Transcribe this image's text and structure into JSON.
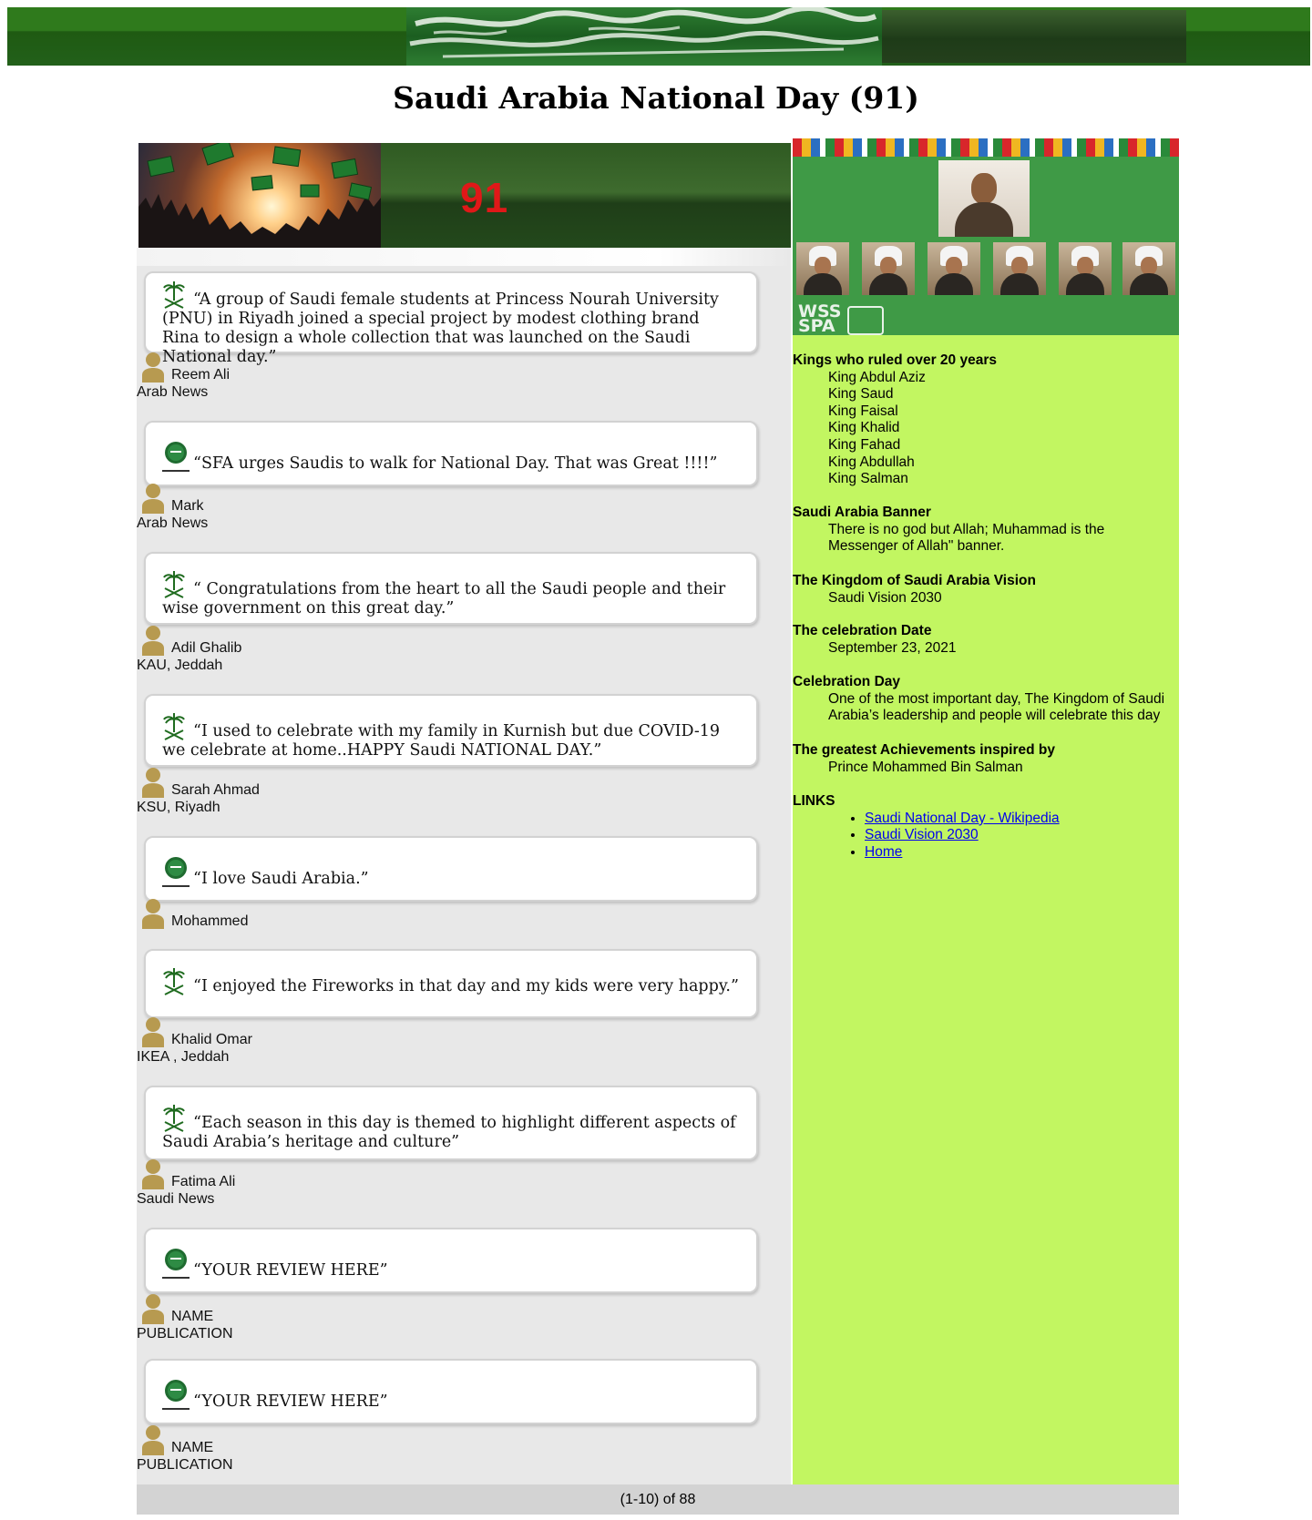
{
  "page_title": "Saudi Arabia National Day (91)",
  "header": {
    "badge_number": "91"
  },
  "reviews": [
    {
      "quote": "“A group of Saudi female students at Princess Nourah University (PNU) in Riyadh joined a special project by modest clothing brand Rina to design a whole collection that was launched on the Saudi National day.”",
      "icon": "palm-swords-icon",
      "name": "Reem Ali",
      "publication": "Arab News"
    },
    {
      "quote": "“SFA urges Saudis to walk for National Day. That was Great !!!!”",
      "icon": "saudi-emblem-icon",
      "name": "Mark",
      "publication": "Arab News"
    },
    {
      "quote": "“ Congratulations from the heart to all the Saudi people and their wise government on this great day.”",
      "icon": "palm-swords-icon",
      "name": "Adil Ghalib",
      "publication": "KAU, Jeddah"
    },
    {
      "quote": "“I used to celebrate with my family in Kurnish but due COVID-19 we celebrate at home..HAPPY Saudi NATIONAL DAY.”",
      "icon": "palm-swords-icon",
      "name": "Sarah Ahmad",
      "publication": "KSU, Riyadh"
    },
    {
      "quote": "“I love Saudi Arabia.”",
      "icon": "saudi-emblem-icon",
      "name": "Mohammed",
      "publication": ""
    },
    {
      "quote": "“I enjoyed the Fireworks in that day and my kids were very happy.”",
      "icon": "palm-swords-icon",
      "name": "Khalid Omar",
      "publication": "IKEA , Jeddah"
    },
    {
      "quote": "“Each season in this day is themed to highlight different aspects of Saudi Arabia’s heritage and culture”",
      "icon": "palm-swords-icon",
      "name": "Fatima Ali",
      "publication": "Saudi News"
    },
    {
      "quote": "“YOUR REVIEW HERE”",
      "icon": "saudi-emblem-icon",
      "name": "NAME",
      "publication": "PUBLICATION"
    },
    {
      "quote": "“YOUR REVIEW HERE”",
      "icon": "saudi-emblem-icon",
      "name": "NAME",
      "publication": "PUBLICATION"
    }
  ],
  "pagination": "(1-10) of 88",
  "sidebar": {
    "kings": {
      "heading": "Kings who ruled over 20 years",
      "items": [
        "King Abdul Aziz",
        "King Saud",
        "King Faisal",
        "King Khalid",
        "King Fahad",
        "King Abdullah",
        "King Salman"
      ]
    },
    "banner": {
      "heading": "Saudi Arabia Banner",
      "text": "There is no god but Allah; Muhammad is the Messenger of Allah\" banner."
    },
    "vision": {
      "heading": "The Kingdom of Saudi Arabia Vision",
      "text": "Saudi Vision 2030"
    },
    "date": {
      "heading": "The celebration Date",
      "text": "September 23, 2021"
    },
    "day": {
      "heading": "Celebration Day",
      "text": "One of the most important day, The Kingdom of Saudi Arabia’s leadership and people will celebrate this day"
    },
    "achievements": {
      "heading": "The greatest Achievements inspired by",
      "text": "Prince Mohammed Bin Salman"
    },
    "links": {
      "heading": "LINKS",
      "items": [
        "Saudi National Day - Wikipedia",
        "Saudi Vision 2030",
        "Home"
      ]
    }
  },
  "colors": {
    "sidebar_bg": "#c2f661",
    "banner_green": "#2f7a1c",
    "badge_red": "#e01818",
    "link": "#0000ee"
  }
}
